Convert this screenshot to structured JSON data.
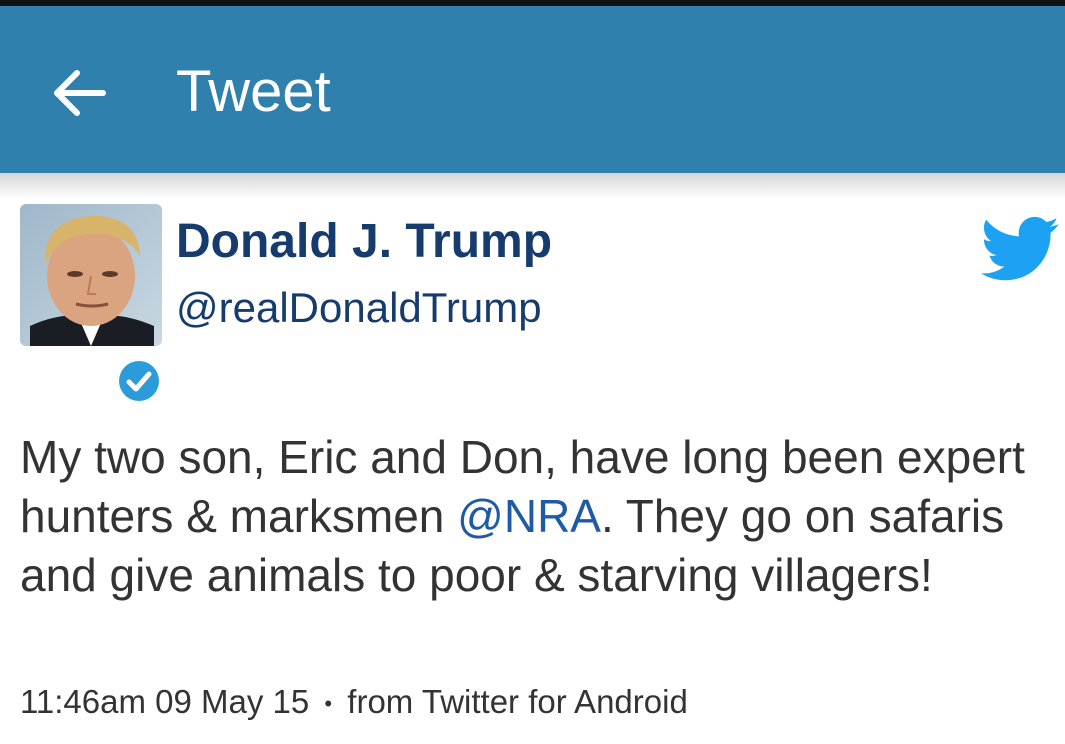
{
  "appbar": {
    "title": "Tweet",
    "back_icon": "back-arrow-icon",
    "background_color": "#2f80ad"
  },
  "tweet": {
    "author": {
      "display_name": "Donald J. Trump",
      "handle": "@realDonaldTrump",
      "verified": true,
      "avatar": "avatar-photo"
    },
    "text_parts": {
      "part1": "My two son, Eric and Don, have long been expert hunters & marksmen ",
      "mention": "@NRA",
      "part2": ". They go on safaris and give  animals to poor & starving villagers!"
    },
    "time": "11:46am 09 May 15",
    "separator": "•",
    "source": "from Twitter for Android",
    "brand_icon": "twitter-bird-icon",
    "colors": {
      "name": "#163c6e",
      "mention": "#1f5aa6",
      "bird": "#1da1f2",
      "verified": "#2b9bd9"
    }
  }
}
